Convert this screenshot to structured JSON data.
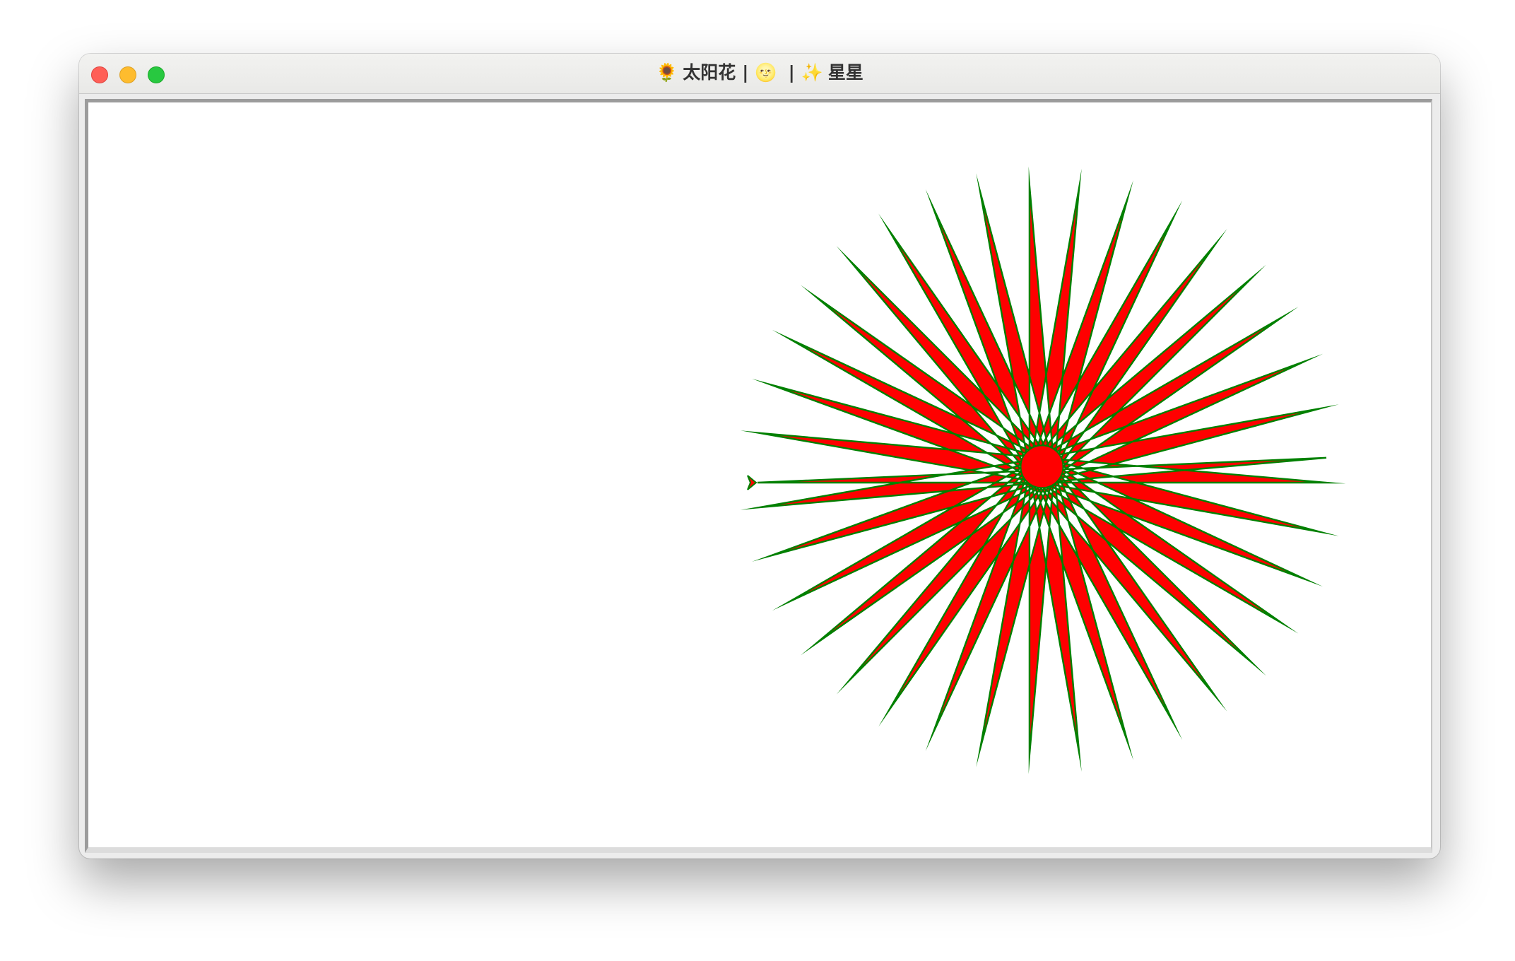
{
  "window": {
    "title_parts": [
      "🌻",
      "太阳花",
      "|",
      "🌝",
      "|",
      "✨",
      "星星"
    ]
  },
  "colors": {
    "fill": "#ff0000",
    "stroke": "#008000",
    "background": "#ffffff"
  },
  "drawing": {
    "ray_count": 36,
    "turtle_heading": "right"
  }
}
